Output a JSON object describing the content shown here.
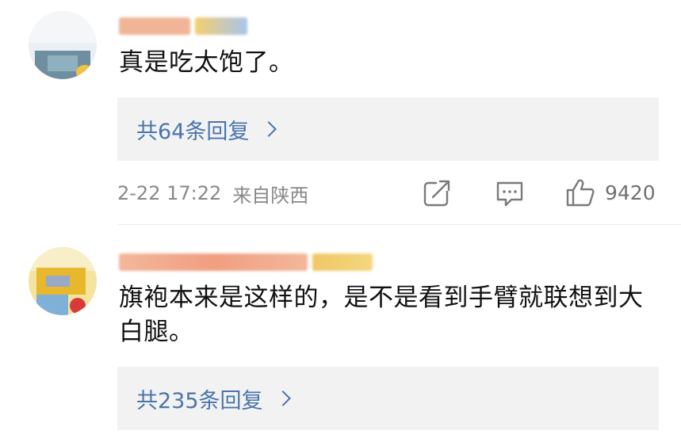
{
  "comments": [
    {
      "text": "真是吃太饱了。",
      "reply_label": "共64条回复",
      "time": "2-22 17:22",
      "location": "来自陕西",
      "like_count": "9420"
    },
    {
      "text": "旗袍本来是这样的，是不是看到手臂就联想到大白腿。",
      "reply_label": "共235条回复"
    }
  ],
  "icons": {
    "share": "share-icon",
    "comment": "comment-icon",
    "like": "thumbs-up-icon",
    "chevron": "chevron-right-icon"
  },
  "colors": {
    "link_blue": "#4a74ac",
    "meta_gray": "#888888",
    "reply_bg": "#f2f2f2"
  }
}
